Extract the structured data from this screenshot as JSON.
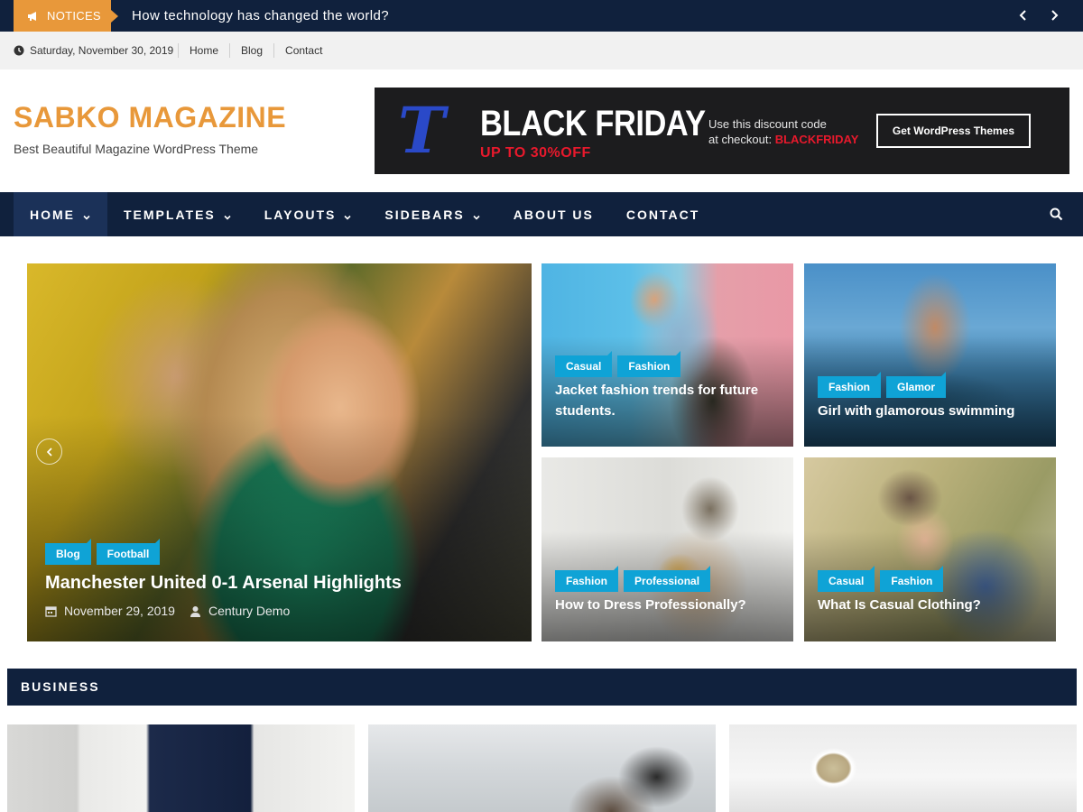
{
  "notices": {
    "label": "NOTICES",
    "headline": "How technology has changed the world?",
    "icons": {
      "label_icon": "megaphone-icon",
      "prev": "chevron-left-icon",
      "next": "chevron-right-icon"
    }
  },
  "topbar": {
    "date": "Saturday, November 30, 2019",
    "links": [
      "Home",
      "Blog",
      "Contact"
    ]
  },
  "header": {
    "site_title": "SABKO MAGAZINE",
    "tagline": "Best Beautiful Magazine WordPress Theme"
  },
  "banner": {
    "title": "BLACK FRIDAY",
    "subtitle": "UP TO 30%OFF",
    "discount_line1": "Use this discount code",
    "discount_line2": "at checkout: ",
    "code": "BLACKFRIDAY",
    "button": "Get WordPress Themes",
    "logo_letter": "T"
  },
  "nav": {
    "items": [
      {
        "label": "HOME",
        "dropdown": true,
        "active": true
      },
      {
        "label": "TEMPLATES",
        "dropdown": true
      },
      {
        "label": "LAYOUTS",
        "dropdown": true
      },
      {
        "label": "SIDEBARS",
        "dropdown": true
      },
      {
        "label": "ABOUT US",
        "dropdown": false
      },
      {
        "label": "CONTACT",
        "dropdown": false
      }
    ]
  },
  "featured": {
    "main": {
      "tags": [
        "Blog",
        "Football"
      ],
      "title": "Manchester United 0-1 Arsenal Highlights",
      "date": "November 29, 2019",
      "author": "Century Demo"
    },
    "cards": [
      {
        "tags": [
          "Casual",
          "Fashion"
        ],
        "title": "Jacket fashion trends for future students."
      },
      {
        "tags": [
          "Fashion",
          "Glamor"
        ],
        "title": "Girl with glamorous swimming"
      },
      {
        "tags": [
          "Fashion",
          "Professional"
        ],
        "title": "How to Dress Professionally?"
      },
      {
        "tags": [
          "Casual",
          "Fashion"
        ],
        "title": "What Is Casual Clothing?"
      }
    ]
  },
  "business": {
    "title": "BUSINESS"
  },
  "colors": {
    "navy": "#10213d",
    "accent_orange": "#e8983a",
    "tag_blue": "#0fa3d6",
    "banner_red": "#e8192c"
  }
}
